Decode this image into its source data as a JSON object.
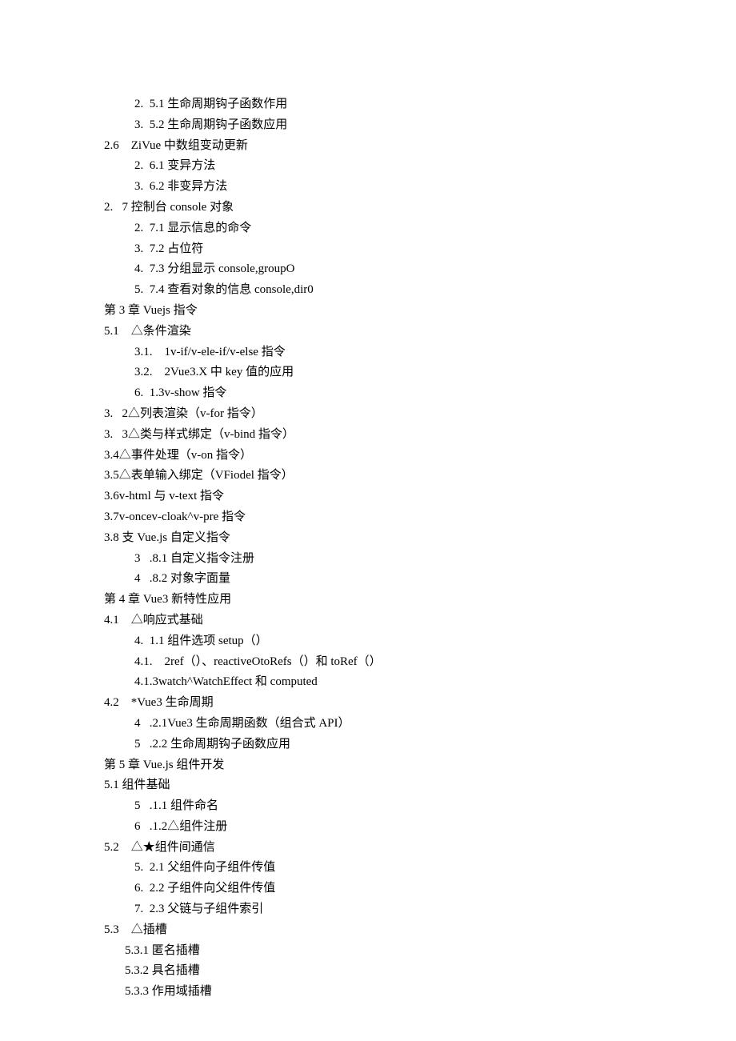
{
  "lines": [
    {
      "indent": 1,
      "text": "2.  5.1 生命周期钩子函数作用"
    },
    {
      "indent": 1,
      "text": "3.  5.2 生命周期钩子函数应用"
    },
    {
      "indent": 0,
      "text": "2.6    ZiVue 中数组变动更新"
    },
    {
      "indent": 1,
      "text": "2.  6.1 变异方法"
    },
    {
      "indent": 1,
      "text": "3.  6.2 非变异方法"
    },
    {
      "indent": 0,
      "text": "2.   7 控制台 console 对象"
    },
    {
      "indent": 1,
      "text": "2.  7.1 显示信息的命令"
    },
    {
      "indent": 1,
      "text": "3.  7.2 占位符"
    },
    {
      "indent": 1,
      "text": "4.  7.3 分组显示 console,groupO"
    },
    {
      "indent": 1,
      "text": "5.  7.4 查看对象的信息 console,dir0"
    },
    {
      "indent": 0,
      "text": "第 3 章 Vuejs 指令"
    },
    {
      "indent": 0,
      "text": "5.1    △条件渲染"
    },
    {
      "indent": 1,
      "text": "3.1.    1v-if/v-ele-if/v-else 指令"
    },
    {
      "indent": 1,
      "text": "3.2.    2Vue3.X 中 key 值的应用"
    },
    {
      "indent": 1,
      "text": "6.  1.3v-show 指令"
    },
    {
      "indent": 0,
      "text": "3.   2△列表渲染（v-for 指令）"
    },
    {
      "indent": 0,
      "text": "3.   3△类与样式绑定（v-bind 指令）"
    },
    {
      "indent": 0,
      "text": "3.4△事件处理（v-on 指令）"
    },
    {
      "indent": 0,
      "text": "3.5△表单输入绑定（VFiodel 指令）"
    },
    {
      "indent": 0,
      "text": "3.6v-html 与 v-text 指令"
    },
    {
      "indent": 0,
      "text": "3.7v-oncev-cloak^v-pre 指令"
    },
    {
      "indent": 0,
      "text": "3.8 支 Vue.js 自定义指令"
    },
    {
      "indent": 1,
      "text": "3   .8.1 自定义指令注册"
    },
    {
      "indent": 1,
      "text": "4   .8.2 对象字面量"
    },
    {
      "indent": 0,
      "text": "第 4 章 Vue3 新特性应用"
    },
    {
      "indent": 0,
      "text": "4.1    △响应式基础"
    },
    {
      "indent": 1,
      "text": "4.  1.1 组件选项 setup（）"
    },
    {
      "indent": 1,
      "text": "4.1.    2ref（）、reactiveOtoRefs（）和 toRef（）"
    },
    {
      "indent": 1,
      "text": "4.1.3watch^WatchEffect 和 computed"
    },
    {
      "indent": 0,
      "text": "4.2    *Vue3 生命周期"
    },
    {
      "indent": 1,
      "text": "4   .2.1Vue3 生命周期函数（组合式 API）"
    },
    {
      "indent": 1,
      "text": "5   .2.2 生命周期钩子函数应用"
    },
    {
      "indent": 0,
      "text": "第 5 章 Vue.js 组件开发"
    },
    {
      "indent": 0,
      "text": "5.1 组件基础"
    },
    {
      "indent": 1,
      "text": "5   .1.1 组件命名"
    },
    {
      "indent": 1,
      "text": "6   .1.2△组件注册"
    },
    {
      "indent": 0,
      "text": "5.2    △★组件间通信"
    },
    {
      "indent": 1,
      "text": "5.  2.1 父组件向子组件传值"
    },
    {
      "indent": 1,
      "text": "6.  2.2 子组件向父组件传值"
    },
    {
      "indent": 1,
      "text": "7.  2.3 父链与子组件索引"
    },
    {
      "indent": 0,
      "text": "5.3    △插槽"
    },
    {
      "indent": 2,
      "text": "5.3.1 匿名插槽"
    },
    {
      "indent": 2,
      "text": "5.3.2 具名插槽"
    },
    {
      "indent": 2,
      "text": "5.3.3 作用域插槽"
    }
  ]
}
